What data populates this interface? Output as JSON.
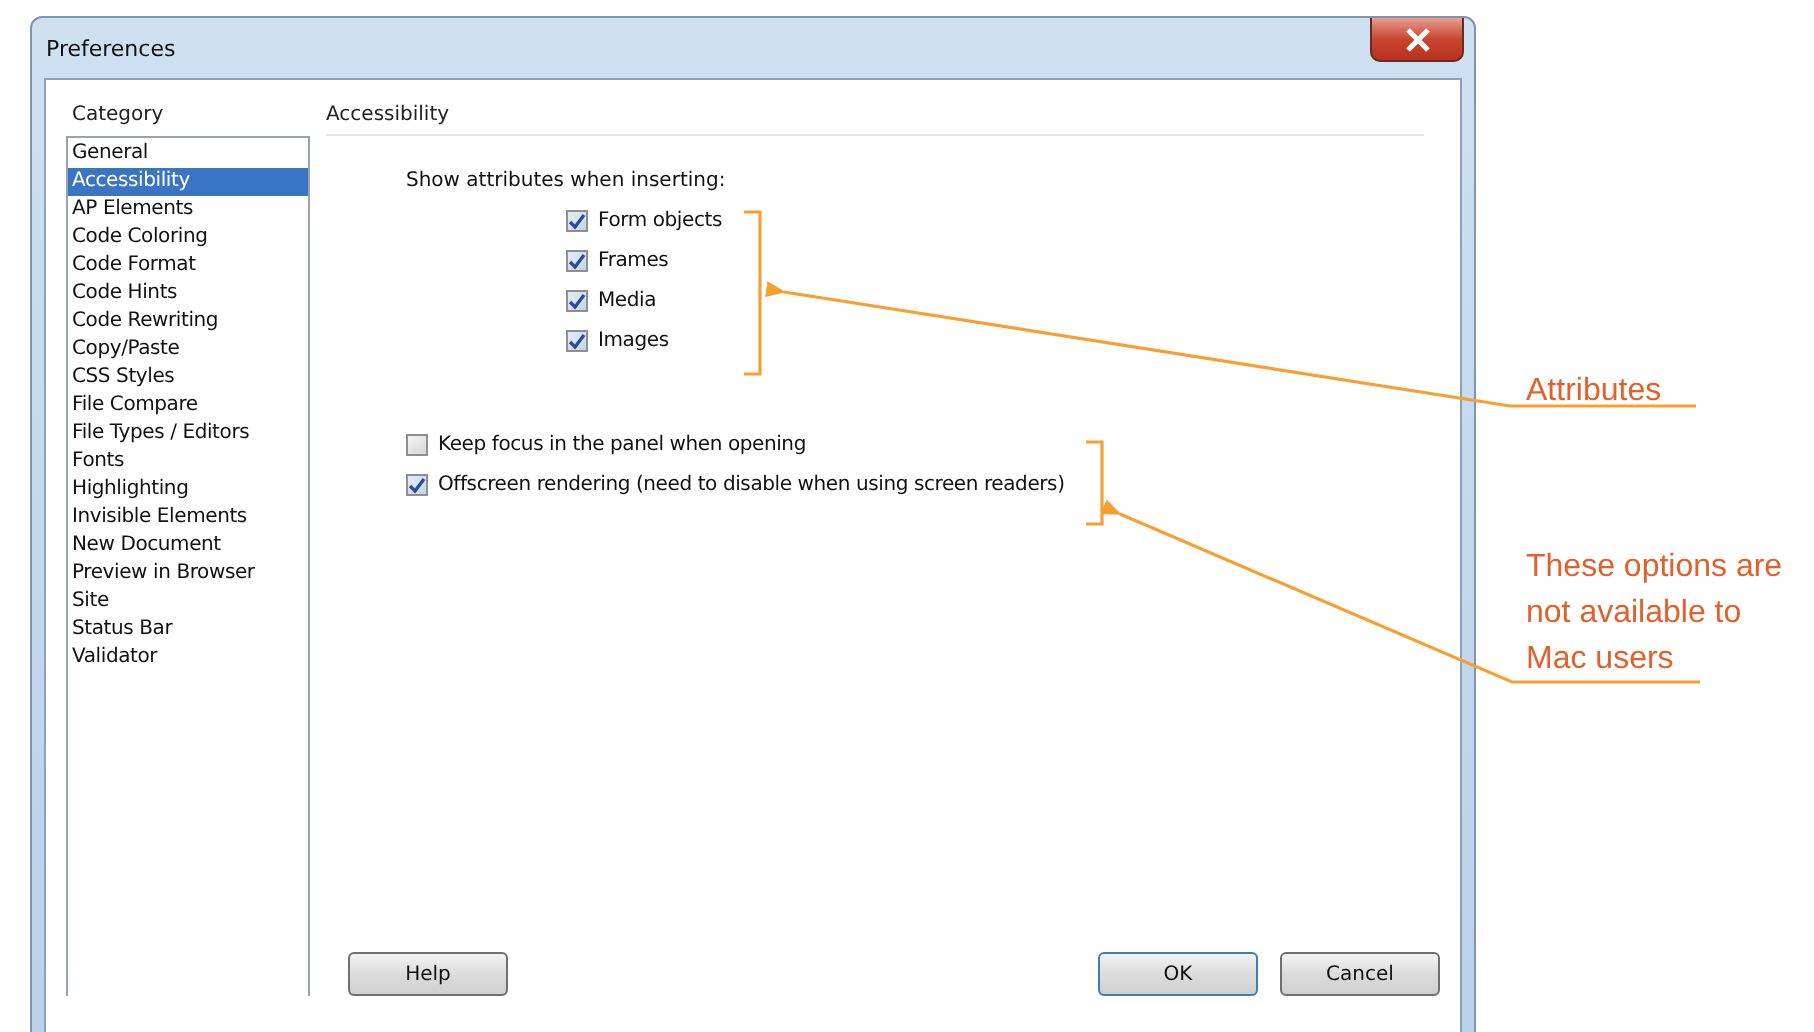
{
  "window": {
    "title": "Preferences"
  },
  "category": {
    "label": "Category",
    "items": [
      {
        "label": "General",
        "selected": false
      },
      {
        "label": "Accessibility",
        "selected": true
      },
      {
        "label": "AP Elements",
        "selected": false
      },
      {
        "label": "Code Coloring",
        "selected": false
      },
      {
        "label": "Code Format",
        "selected": false
      },
      {
        "label": "Code Hints",
        "selected": false
      },
      {
        "label": "Code Rewriting",
        "selected": false
      },
      {
        "label": "Copy/Paste",
        "selected": false
      },
      {
        "label": "CSS Styles",
        "selected": false
      },
      {
        "label": "File Compare",
        "selected": false
      },
      {
        "label": "File Types / Editors",
        "selected": false
      },
      {
        "label": "Fonts",
        "selected": false
      },
      {
        "label": "Highlighting",
        "selected": false
      },
      {
        "label": "Invisible Elements",
        "selected": false
      },
      {
        "label": "New Document",
        "selected": false
      },
      {
        "label": "Preview in Browser",
        "selected": false
      },
      {
        "label": "Site",
        "selected": false
      },
      {
        "label": "Status Bar",
        "selected": false
      },
      {
        "label": "Validator",
        "selected": false
      }
    ]
  },
  "panel": {
    "title": "Accessibility",
    "group_label": "Show attributes when inserting:",
    "attributes": [
      {
        "label": "Form objects",
        "checked": true
      },
      {
        "label": "Frames",
        "checked": true
      },
      {
        "label": "Media",
        "checked": true
      },
      {
        "label": "Images",
        "checked": true
      }
    ],
    "options": [
      {
        "label": "Keep focus in the panel when opening",
        "checked": false
      },
      {
        "label": "Offscreen rendering (need to disable when using screen readers)",
        "checked": true
      }
    ]
  },
  "buttons": [
    {
      "label": "Help",
      "kind": "help"
    },
    {
      "label": "OK",
      "kind": "default"
    },
    {
      "label": "Cancel",
      "kind": "normal"
    }
  ],
  "annotations": [
    {
      "lines": [
        "Attributes"
      ]
    },
    {
      "lines": [
        "These options are",
        "not available to",
        "Mac users"
      ]
    }
  ]
}
